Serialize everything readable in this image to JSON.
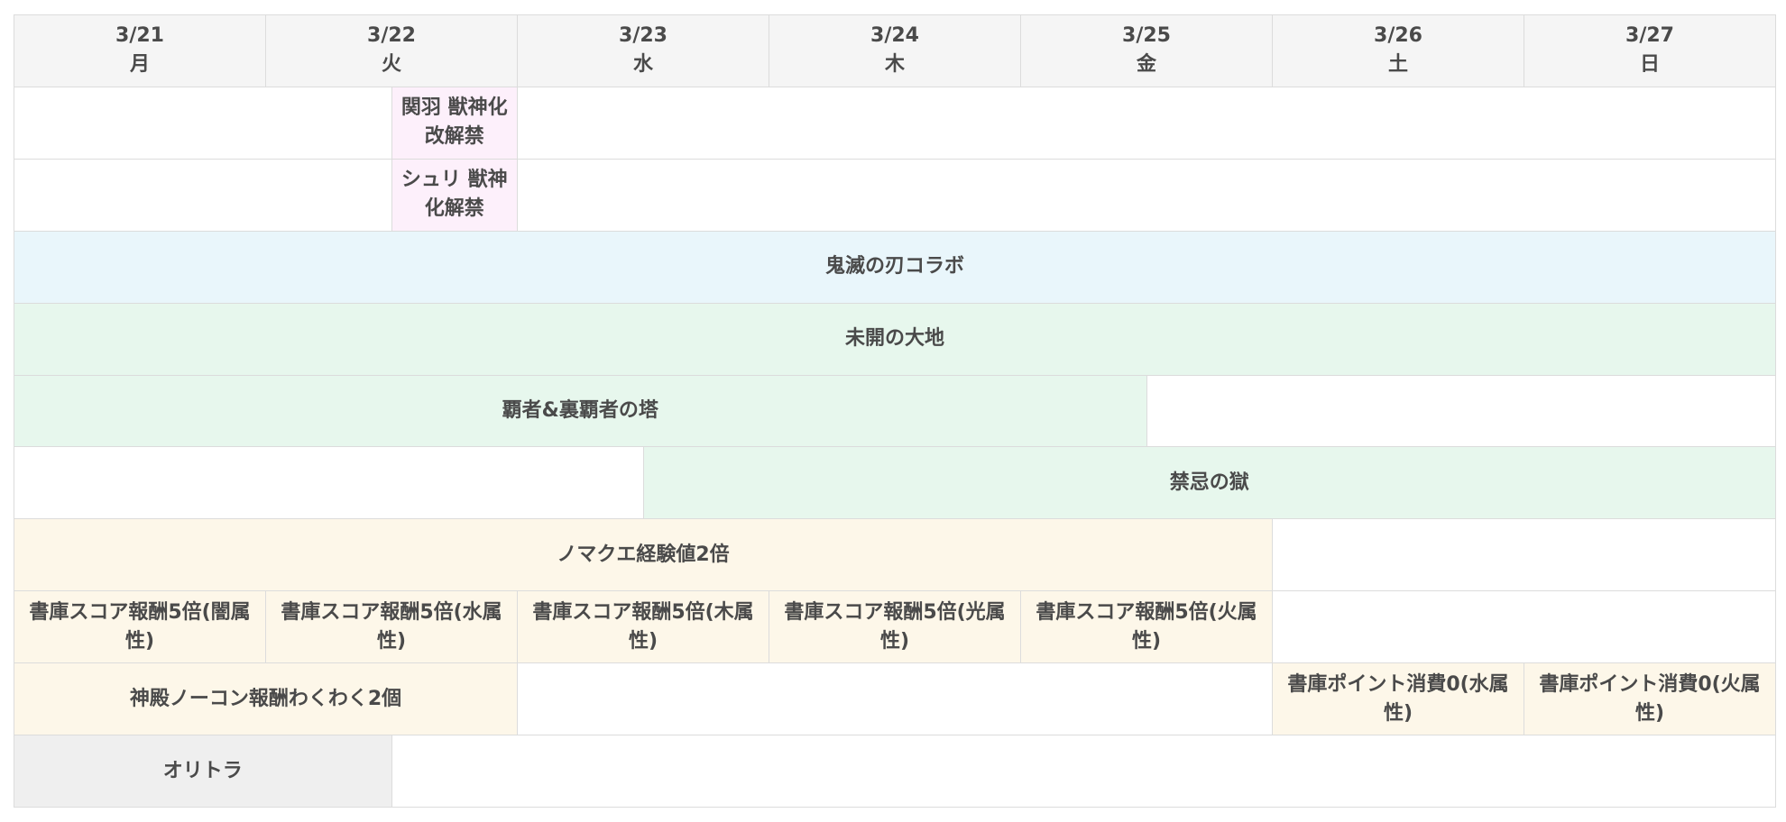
{
  "days": [
    {
      "date": "3/21",
      "weekday": "月"
    },
    {
      "date": "3/22",
      "weekday": "火"
    },
    {
      "date": "3/23",
      "weekday": "水"
    },
    {
      "date": "3/24",
      "weekday": "木"
    },
    {
      "date": "3/25",
      "weekday": "金"
    },
    {
      "date": "3/26",
      "weekday": "土"
    },
    {
      "date": "3/27",
      "weekday": "日"
    }
  ],
  "events": {
    "guanyu": "関羽 獣神化改解禁",
    "shuri": "シュリ 獣神化解禁",
    "kimetsu": "鬼滅の刃コラボ",
    "mikai": "未開の大地",
    "hasha": "覇者&裏覇者の塔",
    "kinki": "禁忌の獄",
    "nomakue": "ノマクエ経験値2倍",
    "shoko_yami": "書庫スコア報酬5倍(闇属性)",
    "shoko_mizu": "書庫スコア報酬5倍(水属性)",
    "shoko_ki": "書庫スコア報酬5倍(木属性)",
    "shoko_hikari": "書庫スコア報酬5倍(光属性)",
    "shoko_hi": "書庫スコア報酬5倍(火属性)",
    "shinden": "神殿ノーコン報酬わくわく2個",
    "point_mizu": "書庫ポイント消費0(水属性)",
    "point_hi": "書庫ポイント消費0(火属性)",
    "oritora": "オリトラ"
  },
  "colors": {
    "header_bg": "#f5f5f5",
    "unlock_pink": "#fdf0fb",
    "collab_blue": "#e9f6fb",
    "dungeon_green": "#e7f7ed",
    "bonus_cream": "#fdf7e9",
    "other_gray": "#efefef",
    "text": "#4a4a4a"
  }
}
